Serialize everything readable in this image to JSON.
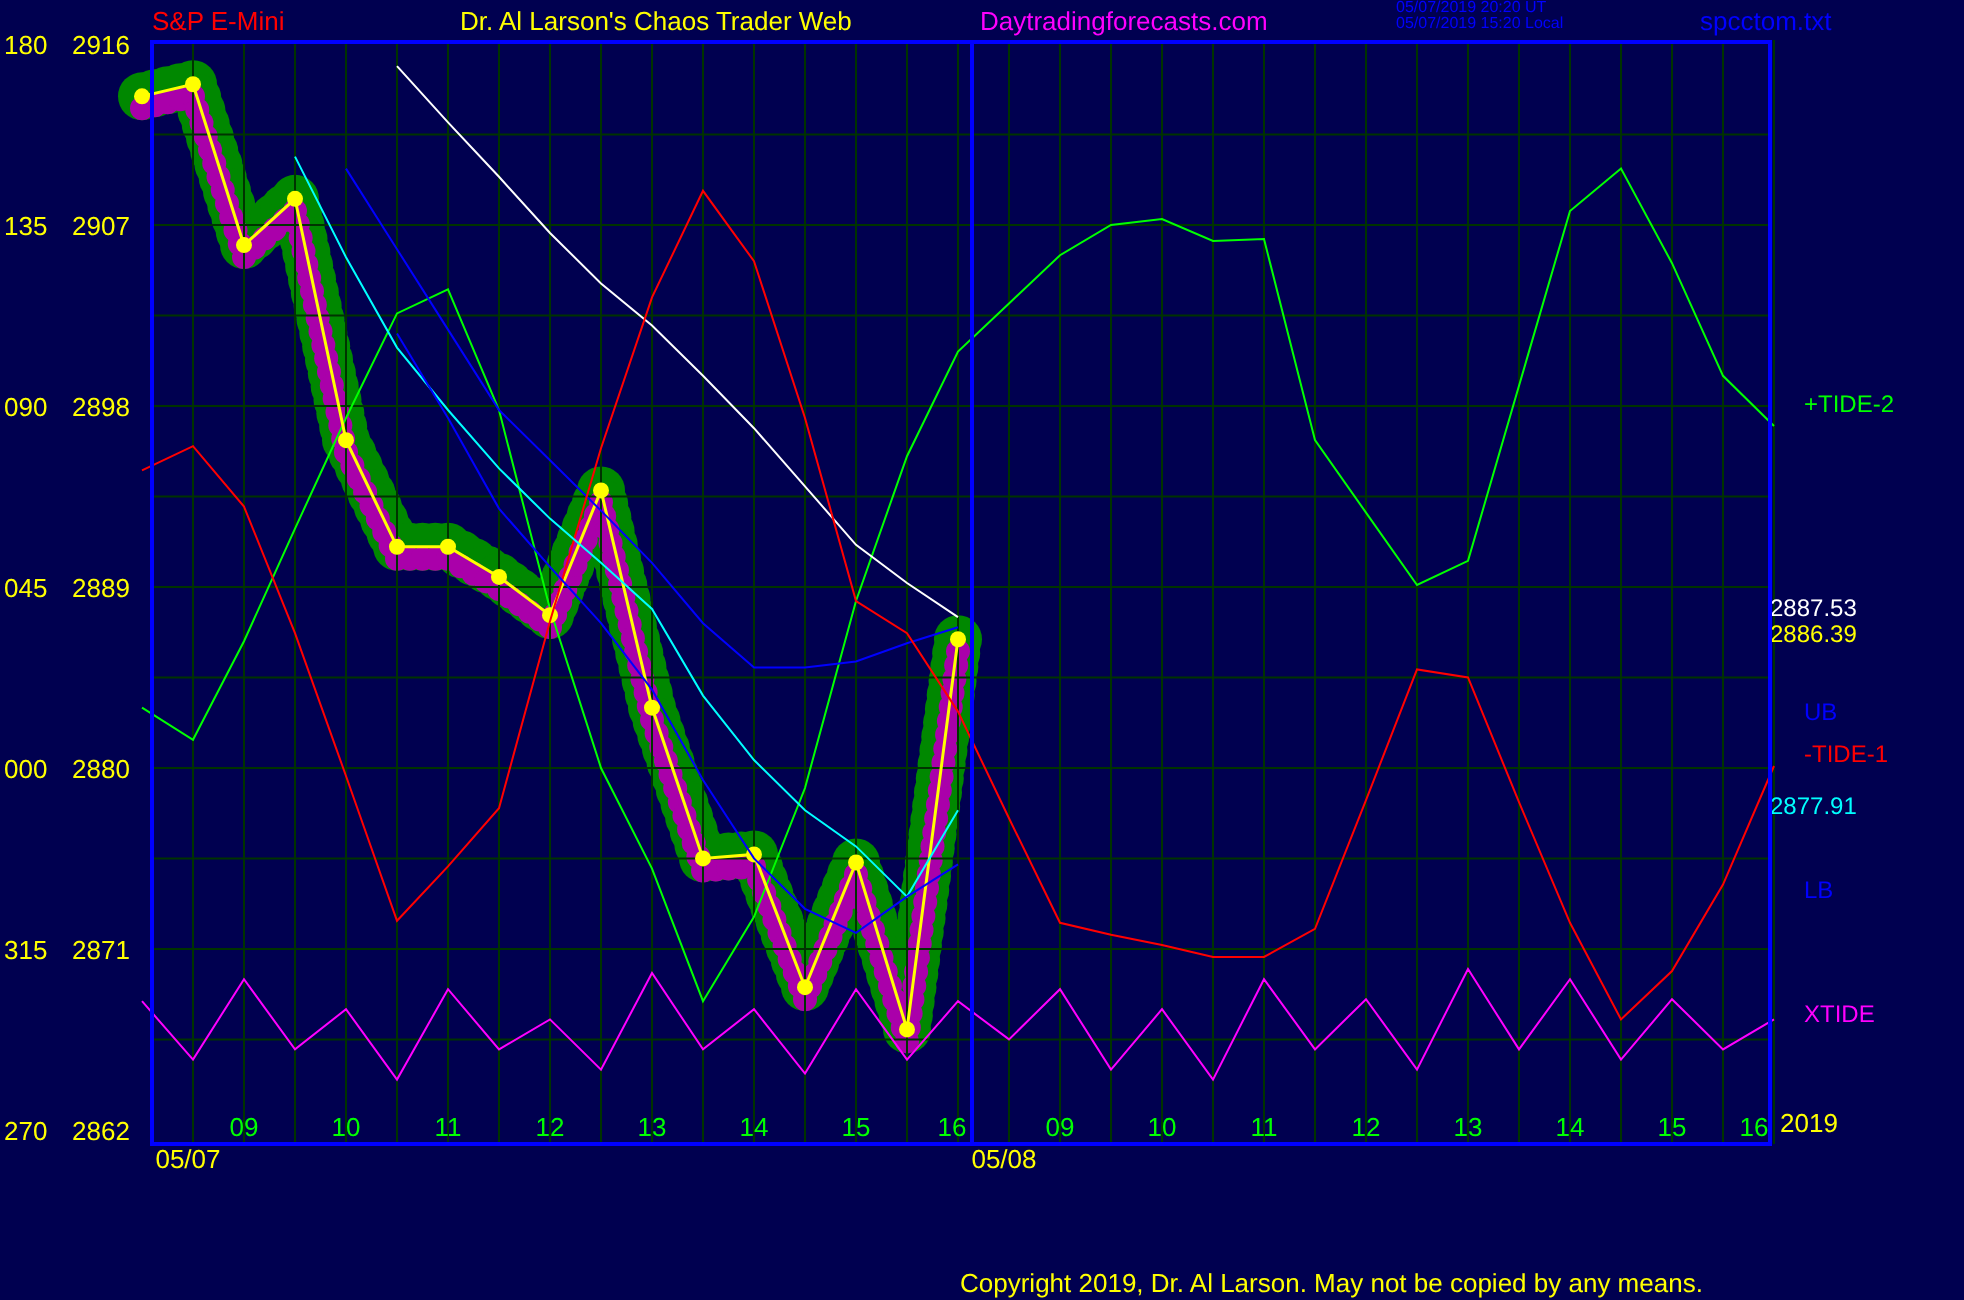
{
  "header": {
    "symbol": "S&P E-Mini",
    "title": "Dr. Al Larson's Chaos Trader Web",
    "site": "Daytradingforecasts.com",
    "timestamps": [
      "05/07/2019 20:20 UT",
      "05/07/2019 15:20 Local"
    ],
    "file": "spcctom.txt"
  },
  "degree_labels": [
    "180",
    "135",
    "090",
    "045",
    "000",
    "315",
    "270"
  ],
  "chart_data": {
    "type": "line",
    "grid": true,
    "ylim": [
      2861.3,
      2916.2
    ],
    "categories": [
      null,
      null,
      "09",
      null,
      "10",
      null,
      "11",
      null,
      "12",
      null,
      "13",
      null,
      "14",
      null,
      "15",
      null,
      "16",
      null,
      "09",
      null,
      "10",
      null,
      "11",
      null,
      "12",
      null,
      "13",
      null,
      "14",
      null,
      "15",
      null,
      "16"
    ],
    "yticks": [
      {
        "value": 2916,
        "label": "2916"
      },
      {
        "value": 2907,
        "label": "2907"
      },
      {
        "value": 2898,
        "label": "2898"
      },
      {
        "value": 2889,
        "label": "2889"
      },
      {
        "value": 2880,
        "label": "2880"
      },
      {
        "value": 2871,
        "label": "2871"
      },
      {
        "value": 2862,
        "label": "2862"
      }
    ],
    "series": [
      {
        "name": "+TIDE-2",
        "color": "#00ff00",
        "values": [
          2883.0,
          2881.4,
          2886.3,
          2891.9,
          2897.4,
          2902.6,
          2903.8,
          2897.8,
          2887.9,
          2880.0,
          2875.0,
          2868.4,
          2872.6,
          2879.0,
          2888.3,
          2895.5,
          2900.7,
          2903.1,
          2905.5,
          2907.0,
          2907.3,
          2906.2,
          2906.3,
          2896.3,
          2892.7,
          2889.1,
          2890.3,
          2899.0,
          2907.7,
          2909.8,
          2905.1,
          2899.5,
          2897.0
        ]
      },
      {
        "name": "2887.53",
        "color": "#ffffff",
        "values": [
          null,
          null,
          null,
          null,
          null,
          2914.9,
          2912.1,
          2909.4,
          2906.6,
          2904.1,
          2902.0,
          2899.5,
          2896.9,
          2894.0,
          2891.1,
          2889.2,
          2887.5,
          null,
          null,
          null,
          null,
          null,
          null,
          null,
          null,
          null,
          null,
          null,
          null,
          null,
          null,
          null,
          null
        ]
      },
      {
        "name": "2886.39",
        "color": "#ffff00",
        "marker": "circle",
        "values": [
          2913.4,
          2914.0,
          2906.0,
          2908.3,
          2896.3,
          2891.0,
          2891.0,
          2889.5,
          2887.6,
          2893.8,
          2883.0,
          2875.5,
          2875.7,
          2869.1,
          2875.3,
          2867.0,
          2886.4,
          null,
          null,
          null,
          null,
          null,
          null,
          null,
          null,
          null,
          null,
          null,
          null,
          null,
          null,
          null,
          null
        ]
      },
      {
        "name": "UB",
        "color": "#0000ff",
        "values": [
          null,
          null,
          null,
          null,
          2909.8,
          2905.8,
          2901.8,
          2897.8,
          2895.3,
          2892.8,
          2890.2,
          2887.2,
          2885.0,
          2885.0,
          2885.3,
          2886.2,
          2887.0,
          null,
          null,
          null,
          null,
          null,
          null,
          null,
          null,
          null,
          null,
          null,
          null,
          null,
          null,
          null,
          null
        ]
      },
      {
        "name": "-TIDE-1",
        "color": "#ff0000",
        "values": [
          2894.8,
          2896.0,
          2893.0,
          2886.7,
          2879.6,
          2872.4,
          2875.1,
          2878.0,
          2887.3,
          2895.9,
          2903.4,
          2908.7,
          2905.2,
          2897.4,
          2888.3,
          2886.7,
          2882.8,
          2877.5,
          2872.3,
          2871.7,
          2871.2,
          2870.6,
          2870.6,
          2872.0,
          2878.4,
          2884.9,
          2884.5,
          2878.3,
          2872.3,
          2867.5,
          2869.9,
          2874.2,
          2880.1
        ]
      },
      {
        "name": "2877.91",
        "color": "#00ffff",
        "values": [
          null,
          null,
          null,
          2910.4,
          2905.4,
          2900.9,
          2897.8,
          2894.9,
          2892.4,
          2890.2,
          2887.9,
          2883.6,
          2880.4,
          2877.9,
          2876.1,
          2873.6,
          2877.9,
          null,
          null,
          null,
          null,
          null,
          null,
          null,
          null,
          null,
          null,
          null,
          null,
          null,
          null,
          null,
          null
        ]
      },
      {
        "name": "LB",
        "color": "#0000ff",
        "values": [
          null,
          null,
          null,
          null,
          null,
          2901.6,
          2897.4,
          2892.9,
          2890.0,
          2887.2,
          2883.9,
          2879.4,
          2875.5,
          2873.0,
          2871.8,
          2873.6,
          2875.2,
          null,
          null,
          null,
          null,
          null,
          null,
          null,
          null,
          null,
          null,
          null,
          null,
          null,
          null,
          null,
          null
        ]
      },
      {
        "name": "XTIDE",
        "color": "#ff00ff",
        "values": [
          2868.4,
          2865.5,
          2869.5,
          2866,
          2868,
          2864.5,
          2869,
          2866,
          2867.5,
          2865,
          2869.8,
          2866,
          2868,
          2864.8,
          2869,
          2865.5,
          2868.4,
          2866.5,
          2869,
          2865,
          2868,
          2864.5,
          2869.5,
          2866,
          2868.5,
          2865,
          2870,
          2866,
          2869.5,
          2865.5,
          2868.5,
          2866,
          2867.5
        ]
      }
    ]
  },
  "sessions": [
    "05/07",
    "05/08"
  ],
  "year": "2019",
  "copyright": "Copyright 2019, Dr. Al Larson. May not be copied by any means."
}
